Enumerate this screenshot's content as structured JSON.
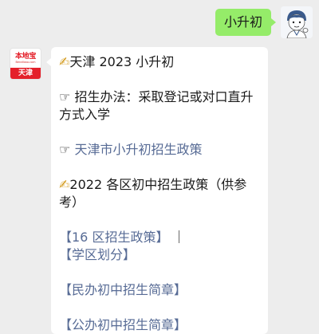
{
  "outgoing": {
    "text": "小升初"
  },
  "incoming": {
    "avatar": {
      "logo_text": "本地宝",
      "logo_url": "Bendibao.com",
      "city": "天津"
    },
    "lines": {
      "title_icon": "✍",
      "title": "天津 2023 小升初",
      "method_icon": "☞",
      "method_text": "招生办法：采取登记或对口直升方式入学",
      "policy_icon": "☞",
      "policy_link": "天津市小升初招生政策",
      "district_icon": "✍",
      "district_text": "2022 各区初中招生政策（供参考）",
      "link_16_districts": "【16 区招生政策】",
      "separator": "｜",
      "link_school_zone": "【学区划分】",
      "link_private": "【民办初中招生简章】",
      "link_public": "【公办初中招生简章】"
    }
  },
  "colors": {
    "chat_background": "#ededed",
    "outgoing_bubble": "#95ec69",
    "incoming_bubble": "#ffffff",
    "link": "#576b95",
    "brand_red": "#e4202a"
  },
  "icons": {
    "user_avatar": "cartoon-avatar-icon",
    "pen": "writing-hand-icon",
    "pointer": "pointing-hand-icon"
  }
}
